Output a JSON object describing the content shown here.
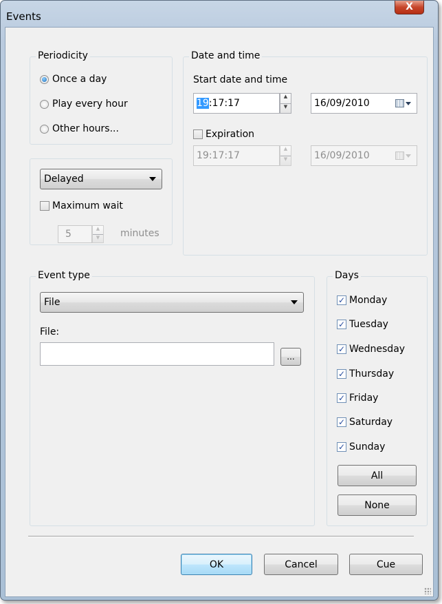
{
  "window": {
    "title": "Events",
    "close_glyph": "X"
  },
  "periodicity": {
    "title": "Periodicity",
    "options": [
      "Once a day",
      "Play every hour",
      "Other hours..."
    ],
    "selected": 0
  },
  "delay": {
    "mode_value": "Delayed",
    "max_wait_label": "Maximum wait",
    "max_wait_checked": false,
    "wait_value": "5",
    "wait_unit": "minutes"
  },
  "date_time": {
    "title": "Date and time",
    "start_label": "Start date and time",
    "start_time_selected": "19",
    "start_time_rest": ":17:17",
    "start_date": "16/09/2010",
    "expiration_label": "Expiration",
    "expiration_checked": false,
    "expiration_time": "19:17:17",
    "expiration_date": "16/09/2010"
  },
  "event_type": {
    "title": "Event type",
    "type_value": "File",
    "file_label": "File:",
    "file_value": "",
    "browse_label": "..."
  },
  "days": {
    "title": "Days",
    "items": [
      {
        "label": "Monday",
        "checked": true
      },
      {
        "label": "Tuesday",
        "checked": true
      },
      {
        "label": "Wednesday",
        "checked": true
      },
      {
        "label": "Thursday",
        "checked": true
      },
      {
        "label": "Friday",
        "checked": true
      },
      {
        "label": "Saturday",
        "checked": true
      },
      {
        "label": "Sunday",
        "checked": true
      }
    ],
    "all_label": "All",
    "none_label": "None"
  },
  "footer": {
    "ok_label": "OK",
    "cancel_label": "Cancel",
    "cue_label": "Cue"
  },
  "icons": {
    "close": "close-icon",
    "calendar": "calendar-icon",
    "dropdown": "chevron-down-icon",
    "spin_up": "spin-up-icon",
    "spin_down": "spin-down-icon",
    "check": "checkmark-icon",
    "resize": "resize-grip-icon"
  },
  "colors": {
    "frame": "#b9cade",
    "client": "#f0f0f0",
    "selection": "#3399ff",
    "close_button": "#c7452a"
  }
}
